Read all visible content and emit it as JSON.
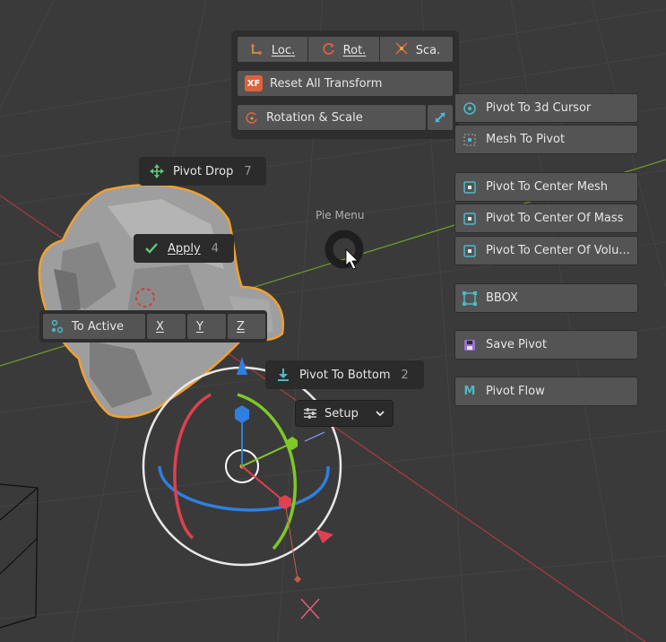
{
  "transform_menu": {
    "loc_label": "Loc.",
    "rot_label": "Rot.",
    "sca_label": "Sca.",
    "reset_label": "Reset All Transform",
    "reset_icon_text": "XF",
    "rotation_scale_label": "Rotation & Scale"
  },
  "right_menu": {
    "items": [
      {
        "label": "Pivot To 3d Cursor",
        "icon": "cursor-target-icon"
      },
      {
        "label": "Mesh To Pivot",
        "icon": "mesh-pivot-icon"
      },
      {
        "label": "Pivot To Center Mesh",
        "icon": "center-dot-icon"
      },
      {
        "label": "Pivot To Center Of Mass",
        "icon": "center-dot-icon"
      },
      {
        "label": "Pivot To Center Of Volu...",
        "icon": "center-dot-icon"
      },
      {
        "label": "BBOX",
        "icon": "bbox-icon"
      },
      {
        "label": "Save Pivot",
        "icon": "save-icon"
      },
      {
        "label": "Pivot Flow",
        "icon": "pivot-flow-icon",
        "icon_text": "M"
      }
    ]
  },
  "pie": {
    "label": "Pie Menu",
    "pivot_drop": {
      "label": "Pivot Drop",
      "num": "7"
    },
    "apply": {
      "label": "Apply",
      "num": "4"
    },
    "pivot_bottom": {
      "label": "Pivot To Bottom",
      "num": "2"
    }
  },
  "to_active": {
    "label": "To Active",
    "x": "X",
    "y": "Y",
    "z": "Z"
  },
  "setup": {
    "label": "Setup"
  },
  "colors": {
    "background": "#3a3a3a",
    "button": "#545454",
    "pill": "#2b2b2b",
    "selection_outline": "#f0a030",
    "x_axis": "#e0404f",
    "y_axis": "#7ec828",
    "z_axis": "#2f7fe0",
    "accent_teal": "#4fb8c8"
  }
}
